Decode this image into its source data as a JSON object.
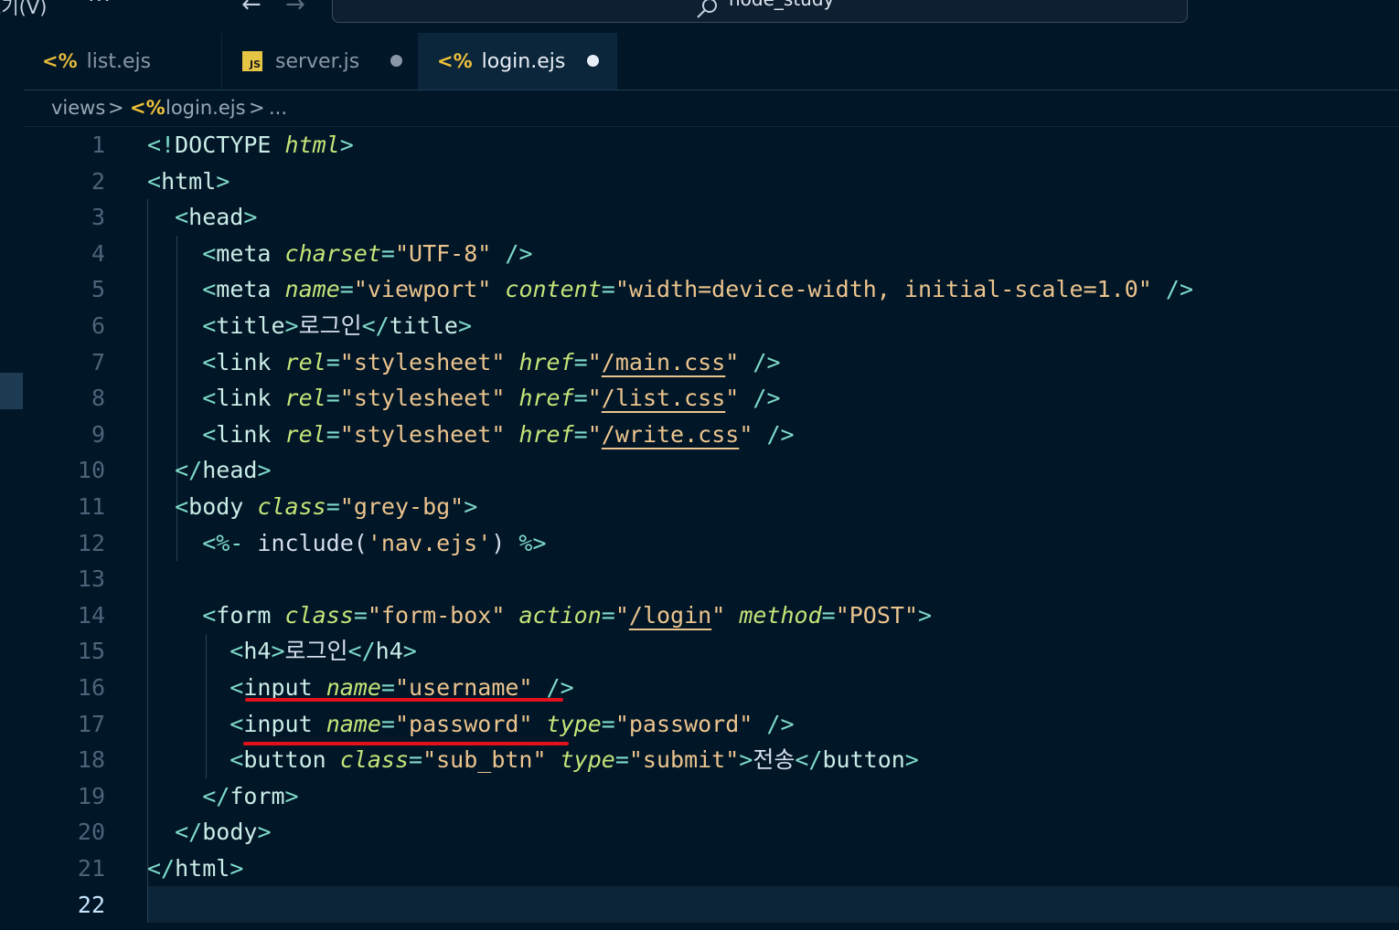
{
  "titlebar": {
    "menu_view": "보기(V)",
    "more": "···",
    "back": "←",
    "forward": "→",
    "search_text": "node_study"
  },
  "tabs": [
    {
      "label": "list.ejs",
      "icon": "ejs-icon",
      "icon_text": "<%",
      "modified": false,
      "active": false
    },
    {
      "label": "server.js",
      "icon": "js-icon",
      "icon_text": "JS",
      "modified": true,
      "active": false
    },
    {
      "label": "login.ejs",
      "icon": "ejs-icon",
      "icon_text": "<%",
      "modified": true,
      "active": true
    }
  ],
  "breadcrumb": {
    "folder": "views",
    "separator": ">",
    "file_icon": "<%",
    "file": "login.ejs",
    "ellipsis": "..."
  },
  "editor": {
    "active_line": 22,
    "line_numbers": [
      "1",
      "2",
      "3",
      "4",
      "5",
      "6",
      "7",
      "8",
      "9",
      "10",
      "11",
      "12",
      "13",
      "14",
      "15",
      "16",
      "17",
      "18",
      "19",
      "20",
      "21",
      "22"
    ],
    "lines": [
      [
        [
          "punc",
          "<!"
        ],
        [
          "tag",
          "DOCTYPE"
        ],
        [
          "punc",
          " "
        ],
        [
          "attr",
          "html"
        ],
        [
          "punc",
          ">"
        ]
      ],
      [
        [
          "punc",
          "<"
        ],
        [
          "tag",
          "html"
        ],
        [
          "punc",
          ">"
        ]
      ],
      [
        [
          "punc",
          "  <"
        ],
        [
          "tag",
          "head"
        ],
        [
          "punc",
          ">"
        ]
      ],
      [
        [
          "punc",
          "    <"
        ],
        [
          "tag",
          "meta"
        ],
        [
          "txt",
          " "
        ],
        [
          "attr",
          "charset"
        ],
        [
          "punc",
          "="
        ],
        [
          "str",
          "\"UTF-8\""
        ],
        [
          "txt",
          " "
        ],
        [
          "punc",
          "/>"
        ]
      ],
      [
        [
          "punc",
          "    <"
        ],
        [
          "tag",
          "meta"
        ],
        [
          "txt",
          " "
        ],
        [
          "attr",
          "name"
        ],
        [
          "punc",
          "="
        ],
        [
          "str",
          "\"viewport\""
        ],
        [
          "txt",
          " "
        ],
        [
          "attr",
          "content"
        ],
        [
          "punc",
          "="
        ],
        [
          "str",
          "\"width=device-width, initial-scale=1.0\""
        ],
        [
          "txt",
          " "
        ],
        [
          "punc",
          "/>"
        ]
      ],
      [
        [
          "punc",
          "    <"
        ],
        [
          "tag",
          "title"
        ],
        [
          "punc",
          ">"
        ],
        [
          "txt",
          "로그인"
        ],
        [
          "punc",
          "</"
        ],
        [
          "tag",
          "title"
        ],
        [
          "punc",
          ">"
        ]
      ],
      [
        [
          "punc",
          "    <"
        ],
        [
          "tag",
          "link"
        ],
        [
          "txt",
          " "
        ],
        [
          "attr",
          "rel"
        ],
        [
          "punc",
          "="
        ],
        [
          "str",
          "\"stylesheet\""
        ],
        [
          "txt",
          " "
        ],
        [
          "attr",
          "href"
        ],
        [
          "punc",
          "="
        ],
        [
          "str",
          "\""
        ],
        [
          "strlink",
          "/main.css"
        ],
        [
          "str",
          "\""
        ],
        [
          "txt",
          " "
        ],
        [
          "punc",
          "/>"
        ]
      ],
      [
        [
          "punc",
          "    <"
        ],
        [
          "tag",
          "link"
        ],
        [
          "txt",
          " "
        ],
        [
          "attr",
          "rel"
        ],
        [
          "punc",
          "="
        ],
        [
          "str",
          "\"stylesheet\""
        ],
        [
          "txt",
          " "
        ],
        [
          "attr",
          "href"
        ],
        [
          "punc",
          "="
        ],
        [
          "str",
          "\""
        ],
        [
          "strlink",
          "/list.css"
        ],
        [
          "str",
          "\""
        ],
        [
          "txt",
          " "
        ],
        [
          "punc",
          "/>"
        ]
      ],
      [
        [
          "punc",
          "    <"
        ],
        [
          "tag",
          "link"
        ],
        [
          "txt",
          " "
        ],
        [
          "attr",
          "rel"
        ],
        [
          "punc",
          "="
        ],
        [
          "str",
          "\"stylesheet\""
        ],
        [
          "txt",
          " "
        ],
        [
          "attr",
          "href"
        ],
        [
          "punc",
          "="
        ],
        [
          "str",
          "\""
        ],
        [
          "strlink",
          "/write.css"
        ],
        [
          "str",
          "\""
        ],
        [
          "txt",
          " "
        ],
        [
          "punc",
          "/>"
        ]
      ],
      [
        [
          "punc",
          "  </"
        ],
        [
          "tag",
          "head"
        ],
        [
          "punc",
          ">"
        ]
      ],
      [
        [
          "punc",
          "  <"
        ],
        [
          "tag",
          "body"
        ],
        [
          "txt",
          " "
        ],
        [
          "attr",
          "class"
        ],
        [
          "punc",
          "="
        ],
        [
          "str",
          "\"grey-bg\""
        ],
        [
          "punc",
          ">"
        ]
      ],
      [
        [
          "punc",
          "    <%-"
        ],
        [
          "txt",
          " include("
        ],
        [
          "str",
          "'nav.ejs'"
        ],
        [
          "txt",
          ") "
        ],
        [
          "punc",
          "%>"
        ]
      ],
      [],
      [
        [
          "punc",
          "    <"
        ],
        [
          "tag",
          "form"
        ],
        [
          "txt",
          " "
        ],
        [
          "attr",
          "class"
        ],
        [
          "punc",
          "="
        ],
        [
          "str",
          "\"form-box\""
        ],
        [
          "txt",
          " "
        ],
        [
          "attr",
          "action"
        ],
        [
          "punc",
          "="
        ],
        [
          "str",
          "\""
        ],
        [
          "strlink",
          "/login"
        ],
        [
          "str",
          "\""
        ],
        [
          "txt",
          " "
        ],
        [
          "attr",
          "method"
        ],
        [
          "punc",
          "="
        ],
        [
          "str",
          "\"POST\""
        ],
        [
          "punc",
          ">"
        ]
      ],
      [
        [
          "punc",
          "      <"
        ],
        [
          "tag",
          "h4"
        ],
        [
          "punc",
          ">"
        ],
        [
          "txt",
          "로그인"
        ],
        [
          "punc",
          "</"
        ],
        [
          "tag",
          "h4"
        ],
        [
          "punc",
          ">"
        ]
      ],
      [
        [
          "punc",
          "      <"
        ],
        [
          "tag",
          "input"
        ],
        [
          "txt",
          " "
        ],
        [
          "attr",
          "name"
        ],
        [
          "punc",
          "="
        ],
        [
          "str",
          "\"username\""
        ],
        [
          "txt",
          " "
        ],
        [
          "punc",
          "/>"
        ]
      ],
      [
        [
          "punc",
          "      <"
        ],
        [
          "tag",
          "input"
        ],
        [
          "txt",
          " "
        ],
        [
          "attr",
          "name"
        ],
        [
          "punc",
          "="
        ],
        [
          "str",
          "\"password\""
        ],
        [
          "txt",
          " "
        ],
        [
          "attr",
          "type"
        ],
        [
          "punc",
          "="
        ],
        [
          "str",
          "\"password\""
        ],
        [
          "txt",
          " "
        ],
        [
          "punc",
          "/>"
        ]
      ],
      [
        [
          "punc",
          "      <"
        ],
        [
          "tag",
          "button"
        ],
        [
          "txt",
          " "
        ],
        [
          "attr",
          "class"
        ],
        [
          "punc",
          "="
        ],
        [
          "str",
          "\"sub_btn\""
        ],
        [
          "txt",
          " "
        ],
        [
          "attr",
          "type"
        ],
        [
          "punc",
          "="
        ],
        [
          "str",
          "\"submit\""
        ],
        [
          "punc",
          ">"
        ],
        [
          "txt",
          "전송"
        ],
        [
          "punc",
          "</"
        ],
        [
          "tag",
          "button"
        ],
        [
          "punc",
          ">"
        ]
      ],
      [
        [
          "punc",
          "    </"
        ],
        [
          "tag",
          "form"
        ],
        [
          "punc",
          ">"
        ]
      ],
      [
        [
          "punc",
          "  </"
        ],
        [
          "tag",
          "body"
        ],
        [
          "punc",
          ">"
        ]
      ],
      [
        [
          "punc",
          "</"
        ],
        [
          "tag",
          "html"
        ],
        [
          "punc",
          ">"
        ]
      ],
      []
    ]
  },
  "annotations": [
    {
      "type": "red-underline",
      "line": 16,
      "covers": "input name=\"username\""
    },
    {
      "type": "red-underline",
      "line": 17,
      "covers": "input name=\"password\""
    }
  ],
  "colors": {
    "background": "#011627",
    "tag": "#caece6",
    "punctuation": "#7fdbca",
    "attribute": "#c5e478",
    "string": "#ecc48d",
    "line_number": "#4b6479",
    "annotation": "#e3111b"
  }
}
